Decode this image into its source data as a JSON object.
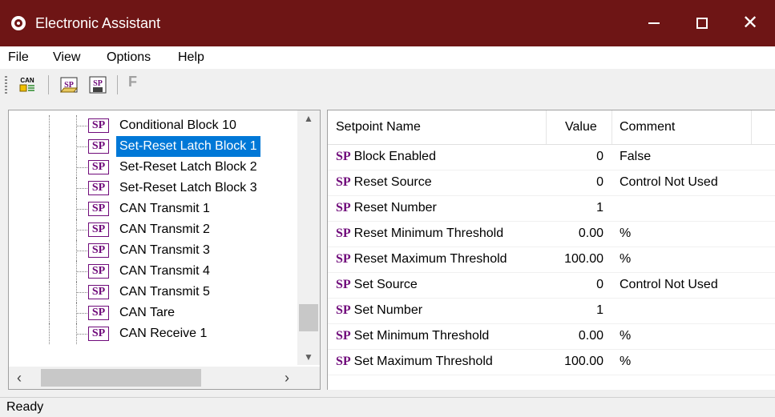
{
  "window": {
    "title": "Electronic Assistant"
  },
  "menu": [
    "File",
    "View",
    "Options",
    "Help"
  ],
  "toolbar": {
    "can_icon_text": "CAN",
    "sp_open_icon_text": "SP",
    "sp_save_icon_text": "SP",
    "f_label": "F"
  },
  "tree": {
    "items": [
      {
        "label": "Conditional Block 10",
        "selected": false
      },
      {
        "label": "Set-Reset Latch Block 1",
        "selected": true
      },
      {
        "label": "Set-Reset Latch Block 2",
        "selected": false
      },
      {
        "label": "Set-Reset Latch Block 3",
        "selected": false
      },
      {
        "label": "CAN Transmit 1",
        "selected": false
      },
      {
        "label": "CAN Transmit 2",
        "selected": false
      },
      {
        "label": "CAN Transmit 3",
        "selected": false
      },
      {
        "label": "CAN Transmit 4",
        "selected": false
      },
      {
        "label": "CAN Transmit 5",
        "selected": false
      },
      {
        "label": "CAN Tare",
        "selected": false
      },
      {
        "label": "CAN Receive 1",
        "selected": false
      }
    ],
    "icon_text": "SP"
  },
  "grid": {
    "headers": {
      "name": "Setpoint Name",
      "value": "Value",
      "comment": "Comment"
    },
    "mark": "SP",
    "rows": [
      {
        "name": "Block Enabled",
        "value": "0",
        "comment": "False"
      },
      {
        "name": "Reset Source",
        "value": "0",
        "comment": "Control Not Used"
      },
      {
        "name": "Reset Number",
        "value": "1",
        "comment": ""
      },
      {
        "name": "Reset Minimum Threshold",
        "value": "0.00",
        "comment": "%"
      },
      {
        "name": "Reset Maximum Threshold",
        "value": "100.00",
        "comment": "%"
      },
      {
        "name": "Set Source",
        "value": "0",
        "comment": "Control Not Used"
      },
      {
        "name": "Set Number",
        "value": "1",
        "comment": ""
      },
      {
        "name": "Set Minimum Threshold",
        "value": "0.00",
        "comment": "%"
      },
      {
        "name": "Set Maximum Threshold",
        "value": "100.00",
        "comment": "%"
      }
    ]
  },
  "status": {
    "text": "Ready"
  },
  "colors": {
    "titlebar": "#6e1515",
    "selection": "#0078d7",
    "sp_mark": "#6f0a7a"
  }
}
